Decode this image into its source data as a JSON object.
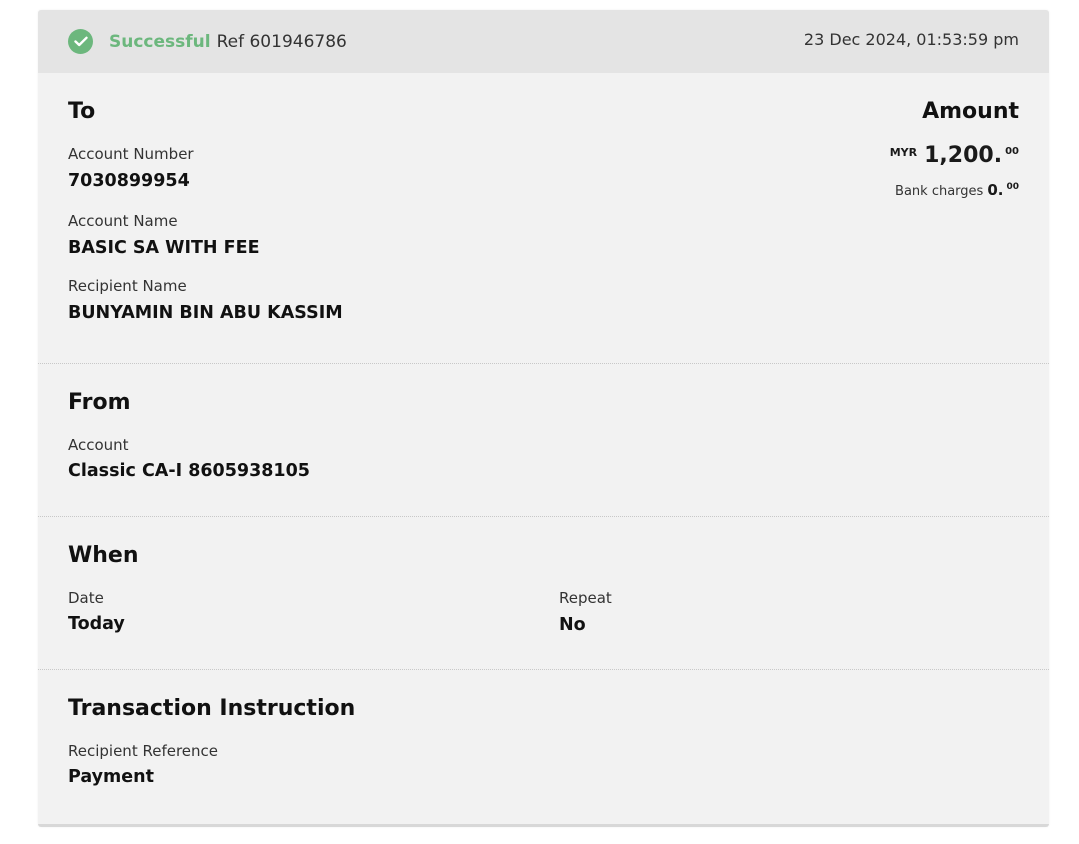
{
  "status": {
    "label": "Successful",
    "ref": "Ref 601946786",
    "datetime": "23 Dec 2024, 01:53:59 pm",
    "icon": "check-circle-icon",
    "color": "#6cb77d"
  },
  "to": {
    "title": "To",
    "account_number_label": "Account Number",
    "account_number": "7030899954",
    "account_name_label": "Account Name",
    "account_name": "BASIC SA WITH FEE",
    "recipient_name_label": "Recipient Name",
    "recipient_name": "BUNYAMIN BIN ABU KASSIM"
  },
  "amount": {
    "title": "Amount",
    "currency": "MYR",
    "value": "1,200.",
    "cents": "00",
    "charges_label": "Bank charges",
    "charges_value": "0.",
    "charges_cents": "00"
  },
  "from": {
    "title": "From",
    "account_label": "Account",
    "account": "Classic CA-I 8605938105"
  },
  "when": {
    "title": "When",
    "date_label": "Date",
    "date": "Today",
    "repeat_label": "Repeat",
    "repeat": "No"
  },
  "instruction": {
    "title": "Transaction Instruction",
    "reference_label": "Recipient Reference",
    "reference": "Payment"
  }
}
